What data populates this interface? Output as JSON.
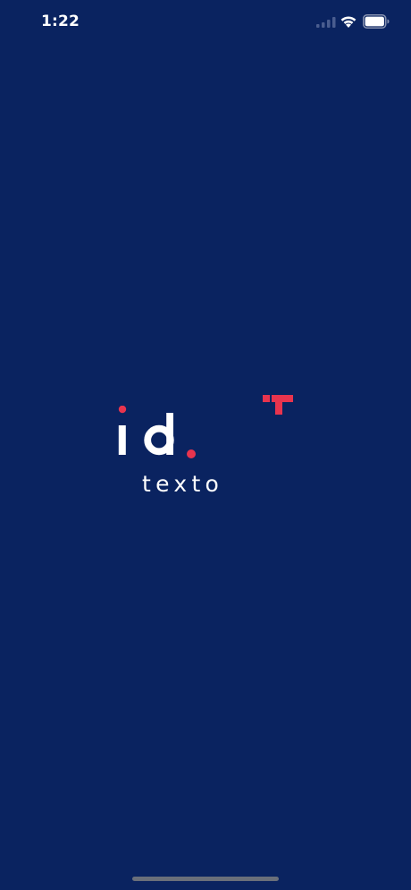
{
  "status_bar": {
    "time": "1:22",
    "icons": [
      "cellular-signal-icon",
      "wifi-icon",
      "battery-icon"
    ]
  },
  "splash": {
    "logo_text": "id.",
    "wordmark": "texto"
  },
  "colors": {
    "background": "#0a2360",
    "accent": "#e8344e",
    "text": "#ffffff",
    "home_indicator": "#6a6f7a"
  }
}
